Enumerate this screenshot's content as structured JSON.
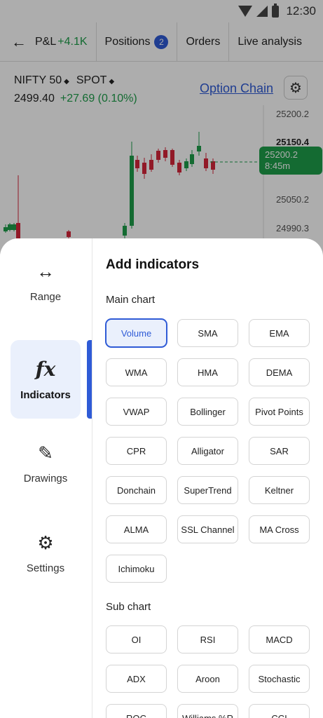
{
  "status_bar": {
    "time": "12:30"
  },
  "nav": {
    "pl_label": "P&L",
    "pl_value": "+4.1K",
    "positions_label": "Positions",
    "positions_count": "2",
    "orders_label": "Orders",
    "live_label": "Live analysis"
  },
  "instrument": {
    "name": "NIFTY 50",
    "segment": "SPOT",
    "price": "2499.40",
    "change": "+27.69 (0.10%)",
    "option_chain": "Option Chain"
  },
  "chart": {
    "axis_labels": [
      "25200.2",
      "25150.4",
      "25050.2",
      "24990.3"
    ],
    "price_tag_value": "25200.2",
    "price_tag_time": "8:45m",
    "colors": {
      "up": "#1e9e4a",
      "down": "#d6263a"
    }
  },
  "sidebar": {
    "items": [
      {
        "label": "Range",
        "icon": "left-right-arrow-icon"
      },
      {
        "label": "Indicators",
        "icon": "fx-icon"
      },
      {
        "label": "Drawings",
        "icon": "pen-icon"
      },
      {
        "label": "Settings",
        "icon": "gear-icon"
      }
    ]
  },
  "panel": {
    "title": "Add indicators",
    "main_chart_title": "Main chart",
    "main_chart": [
      "Volume",
      "SMA",
      "EMA",
      "WMA",
      "HMA",
      "DEMA",
      "VWAP",
      "Bollinger",
      "Pivot Points",
      "CPR",
      "Alligator",
      "SAR",
      "Donchain",
      "SuperTrend",
      "Keltner",
      "ALMA",
      "SSL Channel",
      "MA Cross",
      "Ichimoku"
    ],
    "selected": "Volume",
    "sub_chart_title": "Sub chart",
    "sub_chart": [
      "OI",
      "RSI",
      "MACD",
      "ADX",
      "Aroon",
      "Stochastic",
      "ROC",
      "Williams %R",
      "CCI"
    ]
  }
}
